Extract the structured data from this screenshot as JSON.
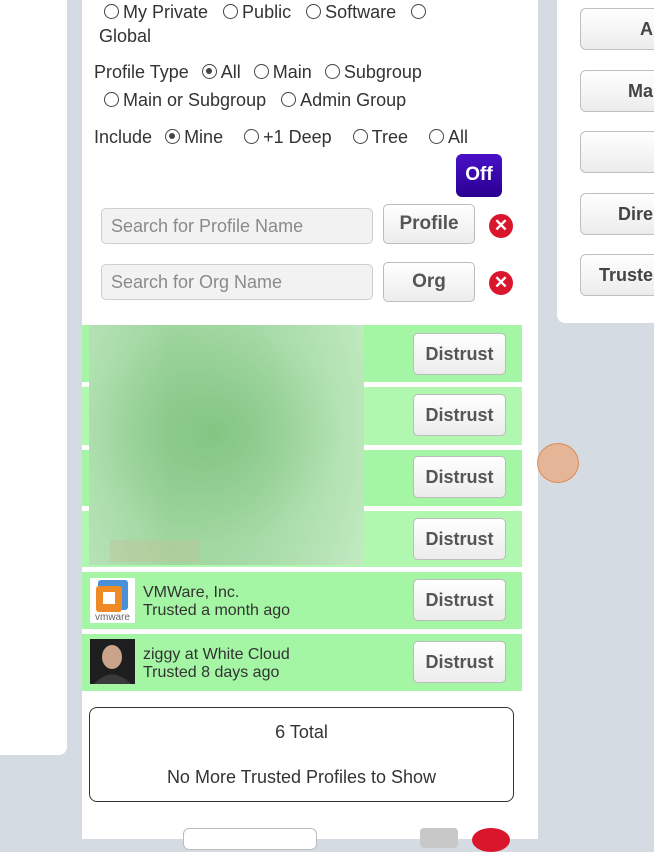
{
  "right_buttons": [
    "A",
    "Ma",
    "",
    "Dire",
    "Truste"
  ],
  "filters": {
    "visibility": {
      "options": [
        "My Private",
        "Public",
        "Software",
        "Global"
      ]
    },
    "profile_type": {
      "label": "Profile Type",
      "options": [
        "All",
        "Main",
        "Subgroup",
        "Main or Subgroup",
        "Admin Group"
      ],
      "selected": "All"
    },
    "include": {
      "label": "Include",
      "options": [
        "Mine",
        "+1 Deep",
        "Tree",
        "All"
      ],
      "selected": "Mine"
    },
    "toggle_label": "Off"
  },
  "search": {
    "profile": {
      "placeholder": "Search for Profile Name",
      "button": "Profile",
      "value": ""
    },
    "org": {
      "placeholder": "Search for Org Name",
      "button": "Org",
      "value": ""
    }
  },
  "trusted_profiles": [
    {
      "name": "",
      "status": "",
      "action": "Distrust"
    },
    {
      "name": "",
      "status": "",
      "action": "Distrust"
    },
    {
      "name": "",
      "status": "",
      "action": "Distrust"
    },
    {
      "name": "",
      "status": "",
      "action": "Distrust"
    },
    {
      "name": "VMWare, Inc.",
      "status": "Trusted a month ago",
      "action": "Distrust",
      "avatar_text": "vmware"
    },
    {
      "name": "ziggy at White Cloud",
      "status": "Trusted 8 days ago",
      "action": "Distrust"
    }
  ],
  "summary": {
    "total": "6 Total",
    "message": "No More Trusted Profiles to Show"
  },
  "colors": {
    "row_green": "#a4f5a4",
    "toggle_purple": "#3a06b0",
    "clear_red": "#d9162b"
  }
}
